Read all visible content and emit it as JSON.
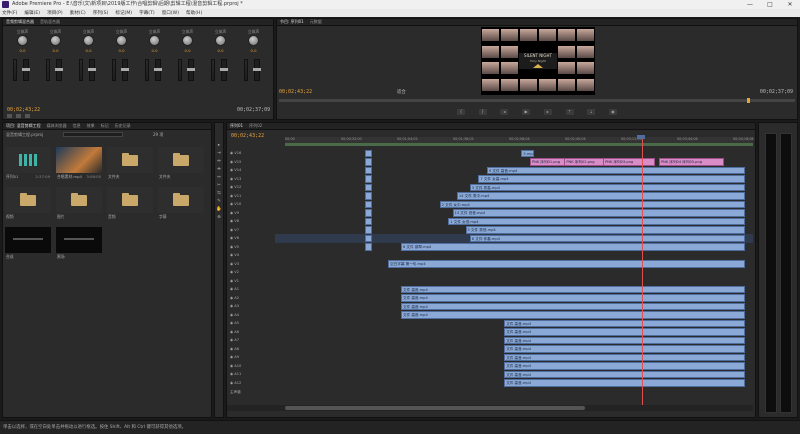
{
  "window": {
    "title": "Adobe Premiere Pro - E:\\音乐\\文\\新项目\\2019版工作\\合唱剪辑\\后期\\剪辑工程\\混音剪辑工程.prproj *",
    "min": "—",
    "max": "□",
    "close": "✕"
  },
  "menu": [
    "文件(F)",
    "编辑(E)",
    "项目(P)",
    "素材(C)",
    "序列(S)",
    "标记(M)",
    "字幕(T)",
    "窗口(W)",
    "帮助(H)"
  ],
  "mixer": {
    "tabs": [
      "音频剪辑混合器",
      "音轨混合器"
    ],
    "channels": [
      "立体声",
      "立体声",
      "立体声",
      "立体声",
      "立体声",
      "立体声",
      "立体声",
      "立体声"
    ],
    "knob_values": [
      "0.0",
      "0.0",
      "0.0",
      "0.0",
      "0.0",
      "0.0",
      "0.0",
      "0.0"
    ],
    "timecode_left": "00;02;43;22",
    "timecode_right": "00;02;37;09"
  },
  "program": {
    "tabs": [
      "节目: 序列01",
      "元数据"
    ],
    "timecode_left": "00;02;43;22",
    "fit_label": "适合",
    "timecode_right": "00;02;37;09",
    "center_title": "SILENT NIGHT",
    "center_subtitle": "Holy Night"
  },
  "project": {
    "tabs": [
      "项目: 混音剪辑工程",
      "媒体浏览器",
      "信息",
      "效果",
      "标记",
      "历史记录"
    ],
    "bin_path": "混音剪辑工程.prproj",
    "count_label": "29 项",
    "items": [
      {
        "label": "序列01",
        "meta": "2:37:09",
        "kind": "seq"
      },
      {
        "label": "合唱素材.mp4",
        "meta": "3:06:00",
        "kind": "video"
      },
      {
        "label": "文件夹",
        "meta": "",
        "kind": "folder"
      },
      {
        "label": "文件夹",
        "meta": "",
        "kind": "folder"
      },
      {
        "label": "视频",
        "meta": "",
        "kind": "folder"
      },
      {
        "label": "图片",
        "meta": "",
        "kind": "folder"
      },
      {
        "label": "音频",
        "meta": "",
        "kind": "folder"
      },
      {
        "label": "字幕",
        "meta": "",
        "kind": "folder"
      },
      {
        "label": "合成",
        "meta": "",
        "kind": "dark"
      },
      {
        "label": "黑场",
        "meta": "",
        "kind": "dark"
      }
    ]
  },
  "timeline": {
    "tabs": [
      "序列01",
      "序列02"
    ],
    "timecode": "00;02;43;22",
    "ruler_marks": [
      "00;00",
      "00;00;32;00",
      "00;01;04;02",
      "00;01;36;02",
      "00;02;08;04",
      "00;02;40;04",
      "00;03;12;06",
      "00;03;44;06",
      "00;04;16;08"
    ],
    "video_tracks": [
      "V16",
      "V15",
      "V14",
      "V13",
      "V12",
      "V11",
      "V10",
      "V9",
      "V8",
      "V7",
      "V6",
      "V5",
      "V4",
      "V3",
      "V2",
      "V1"
    ],
    "audio_tracks": [
      "A1",
      "A2",
      "A3",
      "A4",
      "A5",
      "A6",
      "A7",
      "A8",
      "A9",
      "A10",
      "A11",
      "A12"
    ],
    "master_label": "主声道",
    "clips": [
      {
        "label": "5.mp4",
        "row": 0,
        "start": 0.48,
        "len": 0.03,
        "type": "v"
      },
      {
        "label": "PNK 序列01.png",
        "row": 1,
        "start": 0.5,
        "len": 0.25,
        "type": "pink"
      },
      {
        "label": "PNK 序列02.png",
        "row": 1,
        "start": 0.58,
        "len": 0.1,
        "type": "pink"
      },
      {
        "label": "PNK 序列03.png",
        "row": 1,
        "start": 0.67,
        "len": 0.12,
        "type": "pink"
      },
      {
        "label": "PNK 序列04 序列05.png",
        "row": 1,
        "start": 0.8,
        "len": 0.15,
        "type": "pink"
      },
      {
        "label": "9 文件 高音.mp4",
        "row": 2,
        "start": 0.4,
        "len": 0.6,
        "type": "v"
      },
      {
        "label": "7 文件 女高.mp4",
        "row": 3,
        "start": 0.38,
        "len": 0.62,
        "type": "v"
      },
      {
        "label": "3 文件 男高.mp4",
        "row": 4,
        "start": 0.36,
        "len": 0.64,
        "type": "v"
      },
      {
        "label": "14 文件 男中.mp4",
        "row": 5,
        "start": 0.33,
        "len": 0.67,
        "type": "v"
      },
      {
        "label": "2 文件 女中.mp4",
        "row": 6,
        "start": 0.29,
        "len": 0.71,
        "type": "v"
      },
      {
        "label": "13 文件 低音.mp4",
        "row": 7,
        "start": 0.32,
        "len": 0.68,
        "type": "v"
      },
      {
        "label": "1 文件 女低.mp4",
        "row": 8,
        "start": 0.31,
        "len": 0.69,
        "type": "v"
      },
      {
        "label": "5 文件 男低.mp4",
        "row": 9,
        "start": 0.35,
        "len": 0.65,
        "type": "v"
      },
      {
        "label": "8 文件 伴奏.mp4",
        "row": 10,
        "start": 0.36,
        "len": 0.64,
        "type": "v"
      },
      {
        "label": "6 文件 钢琴.mp4",
        "row": 11,
        "start": 0.2,
        "len": 0.8,
        "type": "v"
      },
      {
        "label": "空白字幕 第一句.mp4",
        "row": 13,
        "start": 0.17,
        "len": 0.83,
        "type": "v"
      }
    ],
    "audio_clip_label": "文件 高音.mp4"
  },
  "status": {
    "text": "单击以选择，或在空白处单击并拖动以进行框选。按住 Shift、Alt 和 Ctrl 键可获得其他选项。"
  },
  "colors": {
    "accent_timecode": "#e8a23a",
    "clip_blue": "#8aa9d6",
    "clip_pink": "#d98cc6",
    "playhead": "#e05050"
  }
}
